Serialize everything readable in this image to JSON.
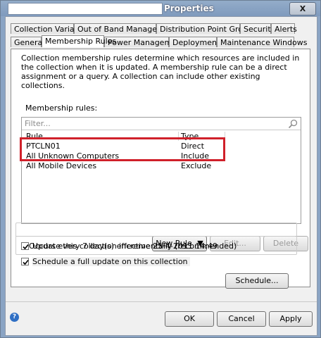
{
  "window": {
    "title": "Properties",
    "close_label": "X"
  },
  "tabs_row1": [
    "Collection Variables",
    "Out of Band Management",
    "Distribution Point Groups",
    "Security",
    "Alerts"
  ],
  "tabs_row2": [
    "General",
    "Membership Rules",
    "Power Management",
    "Deployments",
    "Maintenance Windows"
  ],
  "active_tab": "Membership Rules",
  "panel": {
    "description": "Collection membership rules determine which resources are included in the collection when it is updated. A membership rule can be a direct assignment or a query. A collection can include other existing collections.",
    "rules_label": "Membership rules:",
    "filter_placeholder": "Filter...",
    "columns": {
      "rule": "Rule",
      "type": "Type"
    },
    "rows": [
      {
        "rule": "PTCLN01",
        "type": "Direct"
      },
      {
        "rule": "All Unknown Computers",
        "type": "Include"
      },
      {
        "rule": "All Mobile Devices",
        "type": "Exclude"
      }
    ],
    "buttons": {
      "new_rule": "New Rule",
      "edit": "Edit...",
      "delete": "Delete"
    },
    "incremental": {
      "label": "Update this collection incrementally (recommended)",
      "checked": true
    },
    "full_update": {
      "label": "Schedule a full update on this collection",
      "checked": true,
      "schedule_text": "Occurs every 7 day(s) effective 25-4-2011 14:49",
      "schedule_button": "Schedule..."
    }
  },
  "footer": {
    "ok": "OK",
    "cancel": "Cancel",
    "apply": "Apply"
  },
  "colors": {
    "highlight": "#d0202a",
    "title_bar": "#8aa4c4"
  }
}
